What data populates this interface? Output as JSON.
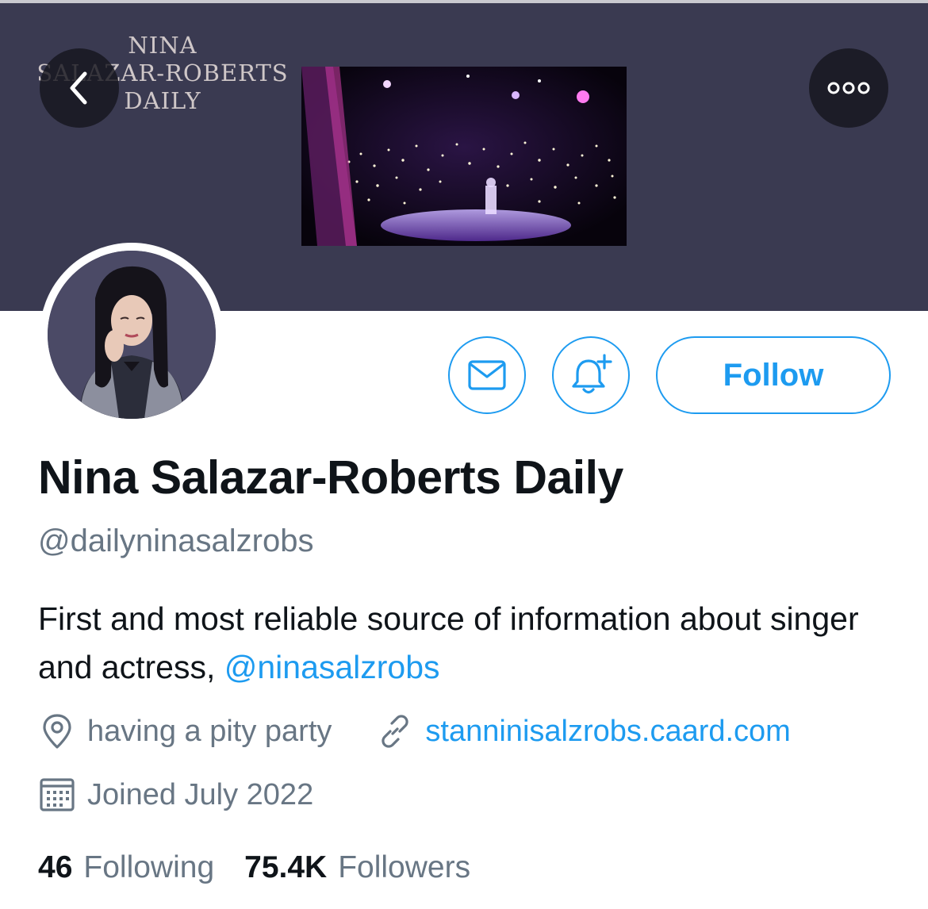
{
  "banner": {
    "title_lines": [
      "NINA",
      "SALAZAR-ROBERTS",
      "DAILY"
    ]
  },
  "nav": {
    "back_icon": "chevron-left-icon",
    "more_icon": "more-dots-icon"
  },
  "actions": {
    "message_icon": "envelope-icon",
    "notify_icon": "bell-plus-icon",
    "follow_label": "Follow"
  },
  "profile": {
    "display_name": "Nina Salazar-Roberts Daily",
    "handle": "@dailyninasalzrobs",
    "bio_text": "First and most reliable source of information about singer and actress, ",
    "bio_mention": "@ninasalzrobs",
    "location": "having a pity party",
    "website": "stanninisalzrobs.caard.com",
    "joined": "Joined July 2022"
  },
  "stats": {
    "following_count": "46",
    "following_label": "Following",
    "followers_count": "75.4K",
    "followers_label": "Followers"
  },
  "colors": {
    "accent": "#1d9bf0",
    "banner_bg": "#3a3a51",
    "secondary_text": "#687684"
  }
}
